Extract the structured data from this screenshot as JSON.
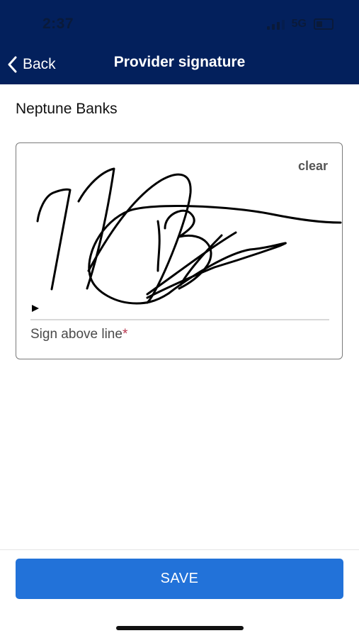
{
  "status_bar": {
    "time": "2:37",
    "network": "5G",
    "icons": [
      "signal-icon",
      "battery-icon"
    ]
  },
  "header": {
    "back_label": "Back",
    "title": "Provider signature"
  },
  "provider": {
    "name": "Neptune Banks"
  },
  "signature": {
    "clear_label": "clear",
    "instruction": "Sign above line",
    "required_mark": "*"
  },
  "footer": {
    "save_label": "SAVE"
  },
  "colors": {
    "header_bg": "#03205c",
    "primary_button": "#2272d9",
    "required": "#b8374f"
  }
}
